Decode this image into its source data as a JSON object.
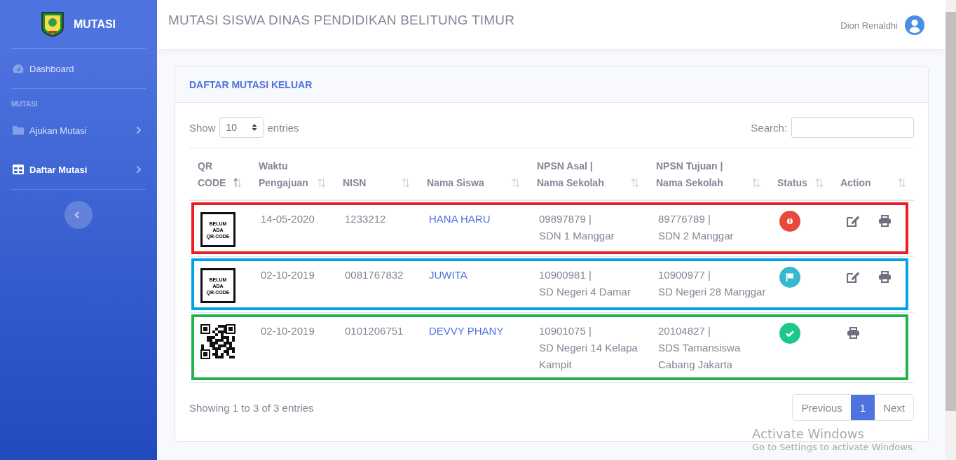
{
  "sidebar": {
    "brand": "MUTASI",
    "items": [
      {
        "kind": "link",
        "label": "Dashboard",
        "selected": false,
        "arrow": false
      },
      {
        "kind": "heading",
        "label": "MUTASI"
      },
      {
        "kind": "link",
        "label": "Ajukan Mutasi",
        "selected": false,
        "arrow": true
      },
      {
        "kind": "link",
        "label": "Daftar Mutasi",
        "selected": true,
        "arrow": true
      }
    ]
  },
  "topbar": {
    "title": "MUTASI SISWA DINAS PENDIDIKAN BELITUNG TIMUR",
    "user": "Dion Renaldhi"
  },
  "card": {
    "title": "DAFTAR MUTASI KELUAR",
    "length": {
      "before": "Show",
      "value": "10",
      "after": "entries"
    },
    "search": {
      "label": "Search:"
    },
    "columns": [
      {
        "label": "QR CODE",
        "sorted": true
      },
      {
        "label": "Waktu Pengajuan",
        "sorted": false
      },
      {
        "label": "NISN",
        "sorted": false
      },
      {
        "label": "Nama Siswa",
        "sorted": false
      },
      {
        "label": "NPSN Asal | Nama Sekolah",
        "sorted": false
      },
      {
        "label": "NPSN Tujuan | Nama Sekolah",
        "sorted": false
      },
      {
        "label": "Status",
        "sorted": false
      },
      {
        "label": "Action",
        "sorted": false
      }
    ],
    "rows": [
      {
        "color": "#ed1c24",
        "qr": {
          "kind": "placeholder",
          "lines": [
            "BELUM",
            "ADA",
            "QR-CODE"
          ]
        },
        "date": "14-05-2020",
        "nisn": "1233212",
        "name": "HANA HARU",
        "from": {
          "npsn": "09897879 |",
          "school": "SDN 1 Manggar"
        },
        "to": {
          "npsn": "89776789 |",
          "school": "SDN 2 Manggar"
        },
        "status": {
          "kind": "info"
        },
        "actions": [
          {
            "kind": "edit"
          },
          {
            "kind": "print"
          }
        ]
      },
      {
        "color": "#00a2e8",
        "qr": {
          "kind": "placeholder",
          "lines": [
            "BELUM",
            "ADA",
            "QR-CODE"
          ]
        },
        "date": "02-10-2019",
        "nisn": "0081767832",
        "name": "JUWITA",
        "from": {
          "npsn": "10900981 |",
          "school": "SD Negeri 4 Damar"
        },
        "to": {
          "npsn": "10900977 |",
          "school": "SD Negeri 28 Manggar"
        },
        "status": {
          "kind": "flag"
        },
        "actions": [
          {
            "kind": "edit"
          },
          {
            "kind": "print"
          }
        ]
      },
      {
        "color": "#22b14c",
        "qr": {
          "kind": "code"
        },
        "date": "02-10-2019",
        "nisn": "0101206751",
        "name": "DEVVY PHANY",
        "from": {
          "npsn": "10901075 |",
          "school": "SD Negeri 14 Kelapa Kampit"
        },
        "to": {
          "npsn": "20104827 |",
          "school": "SDS Tamansiswa Cabang Jakarta"
        },
        "status": {
          "kind": "check"
        },
        "actions": [
          {
            "kind": "print"
          }
        ]
      }
    ],
    "info": "Showing 1 to 3 of 3 entries",
    "pages": [
      {
        "label": "Previous",
        "kind": "nav",
        "selected": false
      },
      {
        "label": "1",
        "kind": "page",
        "selected": true
      },
      {
        "label": "Next",
        "kind": "nav",
        "selected": false
      }
    ]
  },
  "os_overlay": {
    "title": "Activate Windows",
    "subtitle": "Go to Settings to activate Windows."
  }
}
